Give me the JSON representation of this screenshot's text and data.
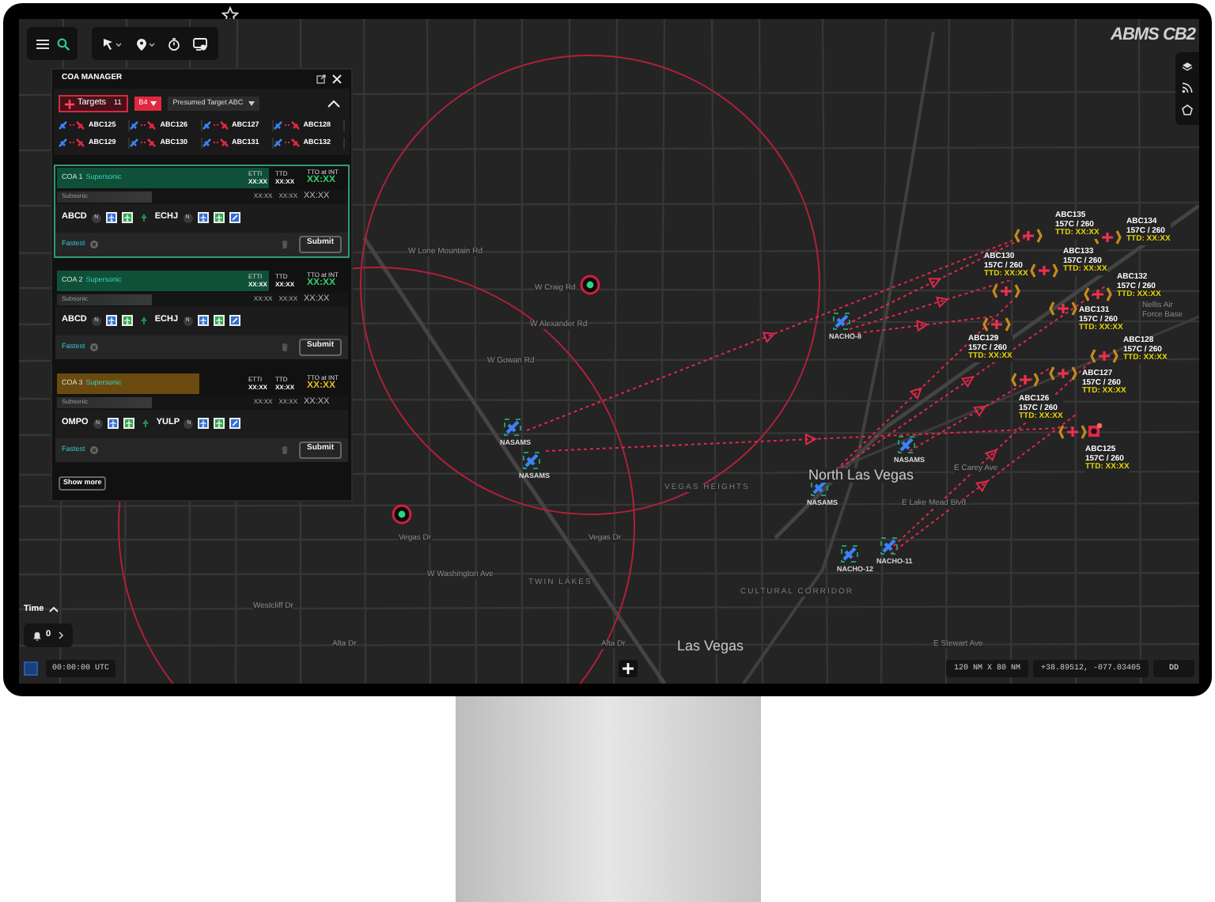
{
  "logo": "ABMS CB2",
  "coa_manager": {
    "title": "COA MANAGER",
    "expanded": true,
    "targets_button": {
      "label": "Targets",
      "count": "11"
    },
    "threat_filter": {
      "label": "B4"
    },
    "target_dropdown": {
      "value": "Presumed Target ABC"
    },
    "targets": [
      {
        "name": "ABC125"
      },
      {
        "name": "ABC126"
      },
      {
        "name": "ABC127"
      },
      {
        "name": "ABC128"
      },
      {
        "name": "ABC129"
      },
      {
        "name": "ABC130"
      },
      {
        "name": "ABC131"
      },
      {
        "name": "ABC132"
      }
    ],
    "coas": [
      {
        "title": "COA 1",
        "mode": "Supersonic",
        "selected": true,
        "color": "#0f5038",
        "etti_label": "ETTI",
        "etti": "XX:XX",
        "ttd_label": "TTD",
        "ttd": "XX:XX",
        "tto_label": "TTO at INT",
        "tto": {
          "text": "XX:XX",
          "color": "#2fd070"
        },
        "subsonic_label": "Subsonic",
        "subsonic_times": [
          "XX:XX",
          "XX:XX",
          "XX:XX"
        ],
        "assets": [
          {
            "name": "ABCD",
            "badge": "N",
            "loadout": [
              {
                "kind": "fighter"
              },
              {
                "kind": "ground"
              }
            ]
          },
          {
            "name": "ECHJ",
            "badge": "N",
            "loadout": [
              {
                "kind": "fighter"
              },
              {
                "kind": "ground"
              },
              {
                "kind": "missile"
              }
            ]
          }
        ],
        "sort": "Fastest",
        "submit": "Submit"
      },
      {
        "title": "COA 2",
        "mode": "Supersonic",
        "selected": false,
        "color": "#0f5038",
        "etti_label": "ETTI",
        "etti": "XX:XX",
        "ttd_label": "TTD",
        "ttd": "XX:XX",
        "tto_label": "TTO at INT",
        "tto": {
          "text": "XX:XX",
          "color": "#2fd070"
        },
        "subsonic_label": "Subsonic",
        "subsonic_times": [
          "XX:XX",
          "XX:XX",
          "XX:XX"
        ],
        "assets": [
          {
            "name": "ABCD",
            "badge": "N",
            "loadout": [
              {
                "kind": "fighter"
              },
              {
                "kind": "ground"
              }
            ]
          },
          {
            "name": "ECHJ",
            "badge": "N",
            "loadout": [
              {
                "kind": "fighter"
              },
              {
                "kind": "ground"
              },
              {
                "kind": "missile"
              }
            ]
          }
        ],
        "sort": "Fastest",
        "submit": "Submit"
      },
      {
        "title": "COA 3",
        "mode": "Supersonic",
        "selected": false,
        "color": "#6a4a0e",
        "etti_label": "ETTI",
        "etti": "XX:XX",
        "ttd_label": "TTD",
        "ttd": "XX:XX",
        "tto_label": "TTO at INT",
        "tto": {
          "text": "XX:XX",
          "color": "#e8b820"
        },
        "subsonic_label": "Subsonic",
        "subsonic_times": [
          "XX:XX",
          "XX:XX",
          "XX:XX"
        ],
        "assets": [
          {
            "name": "OMPO",
            "badge": "N",
            "loadout": [
              {
                "kind": "fighter"
              },
              {
                "kind": "ground"
              }
            ]
          },
          {
            "name": "YULP",
            "badge": "N",
            "loadout": [
              {
                "kind": "fighter"
              },
              {
                "kind": "ground"
              },
              {
                "kind": "missile"
              }
            ]
          }
        ],
        "sort": "Fastest",
        "submit": "Submit"
      }
    ],
    "show_more": "Show more"
  },
  "map": {
    "labels": [
      {
        "text": "W Lone Mountain Rd",
        "kind": "street"
      },
      {
        "text": "W Craig Rd",
        "kind": "street"
      },
      {
        "text": "W Alexander Rd",
        "kind": "street"
      },
      {
        "text": "W Gowan Rd",
        "kind": "street"
      },
      {
        "text": "VEGAS HEIGHTS",
        "kind": "area"
      },
      {
        "text": "North Las Vegas",
        "kind": "city"
      },
      {
        "text": "E Lake Mead Blvd",
        "kind": "street"
      },
      {
        "text": "E Carey Ave",
        "kind": "street"
      },
      {
        "text": "Nellis Air Force Base",
        "kind": "street"
      },
      {
        "text": "Vegas Dr",
        "kind": "street"
      },
      {
        "text": "Vegas Dr",
        "kind": "street"
      },
      {
        "text": "W Washington Ave",
        "kind": "street"
      },
      {
        "text": "TWIN LAKES",
        "kind": "area"
      },
      {
        "text": "CULTURAL CORRIDOR",
        "kind": "area"
      },
      {
        "text": "Westcliff Dr",
        "kind": "street"
      },
      {
        "text": "Alta Dr",
        "kind": "street"
      },
      {
        "text": "Alta Dr",
        "kind": "street"
      },
      {
        "text": "Las Vegas",
        "kind": "city"
      },
      {
        "text": "E Stewart Ave",
        "kind": "street"
      }
    ],
    "friendlies": [
      {
        "name": "NASAMS"
      },
      {
        "name": "NASAMS"
      },
      {
        "name": "NACHO-8"
      },
      {
        "name": "NASAMS"
      },
      {
        "name": "NASAMS"
      },
      {
        "name": "NACHO-12"
      },
      {
        "name": "NACHO-11"
      }
    ],
    "tracks": [
      {
        "name": "ABC135",
        "info": "157C / 260",
        "ttd": "TTD: XX:XX"
      },
      {
        "name": "ABC134",
        "info": "157C / 260",
        "ttd": "TTD: XX:XX"
      },
      {
        "name": "ABC133",
        "info": "157C / 260",
        "ttd": "TTD: XX:XX"
      },
      {
        "name": "ABC132",
        "info": "157C / 260",
        "ttd": "TTD: XX:XX"
      },
      {
        "name": "ABC131",
        "info": "157C / 260",
        "ttd": "TTD: XX:XX"
      },
      {
        "name": "ABC130",
        "info": "157C / 260",
        "ttd": "TTD: XX:XX"
      },
      {
        "name": "ABC129",
        "info": "157C / 260",
        "ttd": "TTD: XX:XX"
      },
      {
        "name": "ABC128",
        "info": "157C / 260",
        "ttd": "TTD: XX:XX"
      },
      {
        "name": "ABC127",
        "info": "157C / 260",
        "ttd": "TTD: XX:XX"
      },
      {
        "name": "ABC126",
        "info": "157C / 260",
        "ttd": "TTD: XX:XX"
      },
      {
        "name": "ABC125",
        "info": "157C / 260",
        "ttd": "TTD: XX:XX"
      }
    ]
  },
  "time_panel": {
    "title": "Time",
    "expanded": true,
    "alerts": "0"
  },
  "status_bar": {
    "clock": "00:00:00 UTC",
    "scale": "120 NM X 80 NM",
    "coordinates": "+38.89512, -077.03405",
    "format": "DD"
  }
}
